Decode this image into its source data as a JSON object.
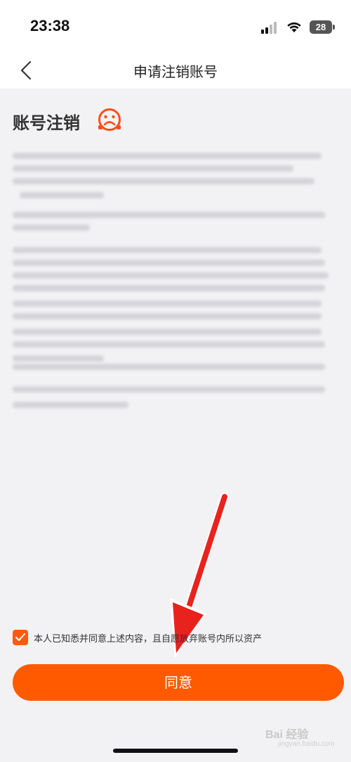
{
  "status_bar": {
    "time": "23:38",
    "battery": "28"
  },
  "nav": {
    "title": "申请注销账号"
  },
  "section": {
    "title": "账号注销",
    "icon": "sad-face-icon"
  },
  "agreement": {
    "checked": true,
    "text": "本人已知悉并同意上述内容，且自愿放弃账号内所以资产"
  },
  "button": {
    "label": "同意"
  },
  "colors": {
    "accent": "#ff5a00",
    "checkbox": "#ff5a10"
  },
  "watermark": {
    "brand": "Bai 经验",
    "sub": "jingyan.baidu.com"
  }
}
